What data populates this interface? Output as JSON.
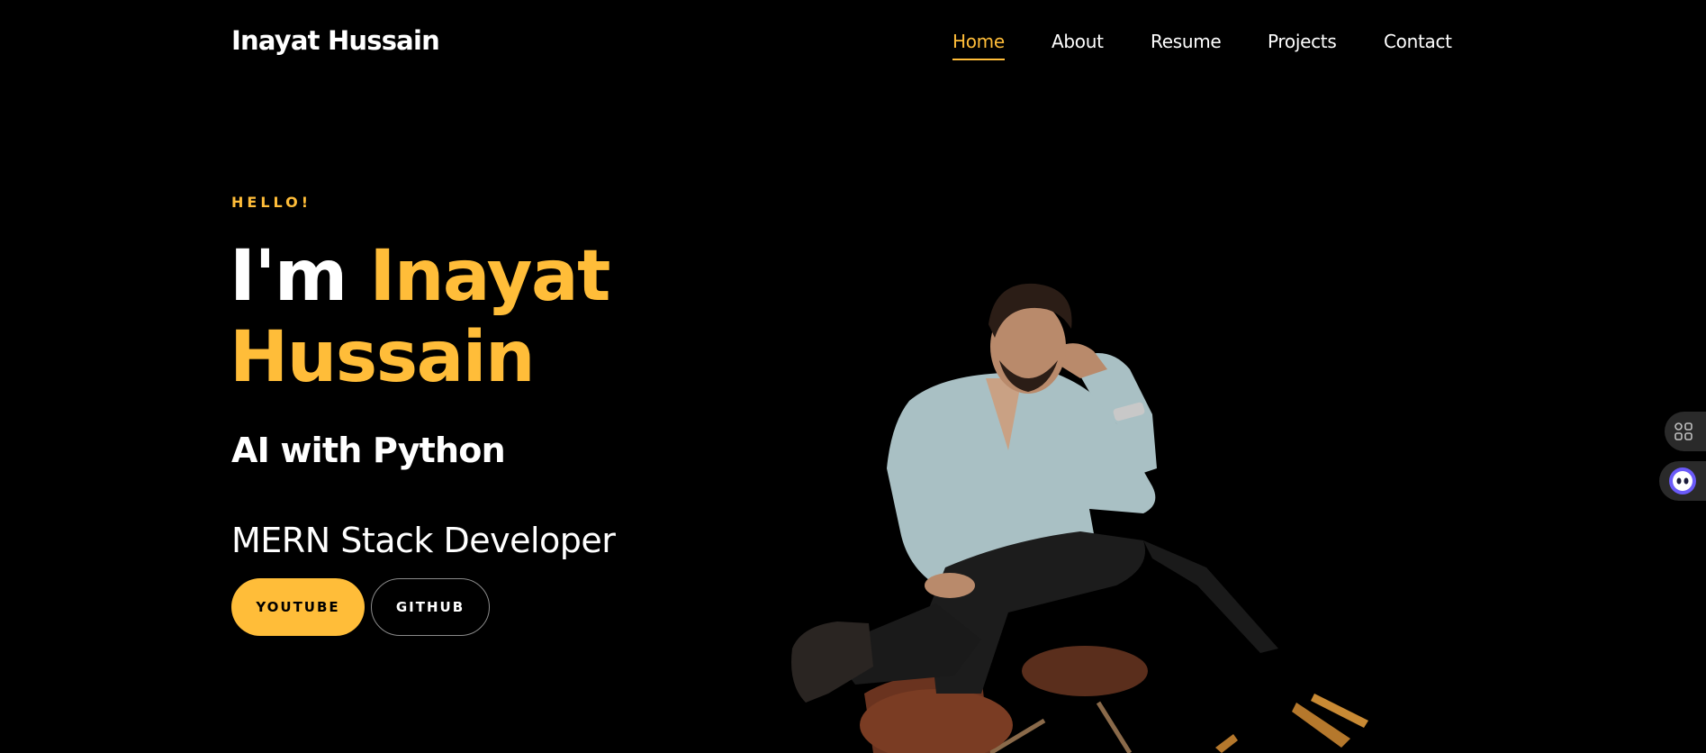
{
  "header": {
    "brand": "Inayat Hussain",
    "nav": [
      {
        "label": "Home",
        "active": true
      },
      {
        "label": "About",
        "active": false
      },
      {
        "label": "Resume",
        "active": false
      },
      {
        "label": "Projects",
        "active": false
      },
      {
        "label": "Contact",
        "active": false
      }
    ]
  },
  "hero": {
    "greeting": "HELLO!",
    "intro_prefix": "I'm",
    "name_first": "Inayat",
    "name_last": "Hussain",
    "subtitle": "AI with Python",
    "role": "MERN Stack Developer",
    "buttons": {
      "youtube_label": "YOUTUBE",
      "github_label": "GITHUB"
    }
  },
  "widgets": {
    "apps_icon": "apps-grid-icon",
    "assistant_icon": "assistant-bot-icon"
  },
  "colors": {
    "background": "#000000",
    "accent": "#ffbd39",
    "text": "#ffffff"
  }
}
